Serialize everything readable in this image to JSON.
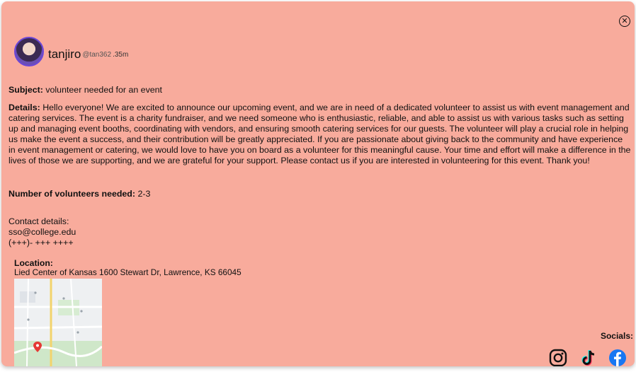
{
  "header": {
    "username": "tanjiro",
    "handle": "@tan362",
    "time": ".35m"
  },
  "subject": {
    "label": "Subject:",
    "value": "volunteer needed for an event"
  },
  "details": {
    "label": "Details:",
    "value": "Hello everyone! We are excited to announce our upcoming event, and we are in need of a dedicated volunteer to assist us with event management and catering services. The event is a charity fundraiser, and we need someone who is enthusiastic, reliable, and able to assist us with various tasks such as setting up and managing event booths, coordinating with vendors, and ensuring smooth catering services for our guests. The volunteer will play a crucial role in helping us make the event a success, and their contribution will be greatly appreciated. If you are passionate about giving back to the community and have experience in event management or catering, we would love to have you on board as a volunteer for this meaningful cause. Your time and effort will make a difference in the lives of those we are supporting, and we are grateful for your support. Please contact us if you are interested in volunteering for this event. Thank you!"
  },
  "volunteers": {
    "label": "Number of volunteers needed:",
    "value": "2-3"
  },
  "contact": {
    "label": "Contact details:",
    "email": "sso@college.edu",
    "phone": "(+++)- +++ ++++"
  },
  "location": {
    "label": "Location:",
    "address": "Lied Center of Kansas 1600 Stewart Dr, Lawrence, KS 66045"
  },
  "socials": {
    "label": "Socials:",
    "items": [
      "instagram",
      "tiktok",
      "facebook"
    ]
  },
  "colors": {
    "card_background": "#f8ab9c",
    "facebook": "#1877f2",
    "map_pin": "#e53935"
  }
}
